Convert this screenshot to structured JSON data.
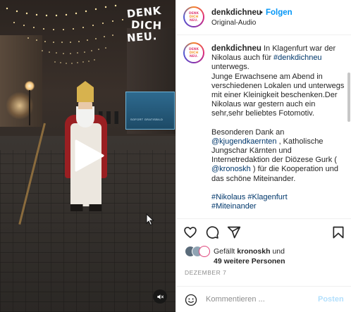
{
  "video": {
    "logo_lines": [
      "DENK",
      "DICH",
      "NEU."
    ],
    "shop_sign_text": "SOFORT GRATISBILD"
  },
  "header": {
    "username": "denkdichneu",
    "separator": "•",
    "follow_label": "Folgen",
    "audio_label": "Original-Audio"
  },
  "avatar": {
    "lines": [
      "DENK",
      "DICH",
      "NEU."
    ]
  },
  "caption": {
    "username": "denkdichneu",
    "p1_intro": " In Klagenfurt war der Nikolaus auch für ",
    "p1_hashtag": "#denkdichneu",
    "p1_rest": " unterwegs.",
    "p2": "Junge Erwachsene am Abend in verschiedenen Lokalen und unterwegs mit einer Kleinigkeit beschenken.Der Nikolaus war gestern auch ein sehr,sehr beliebtes Fotomotiv.",
    "p3_intro": "Besonderen Dank an ",
    "p3_mention1": "@kjugendkaernten",
    "p3_mid1": " , Katholische Jungschar Kärnten und Internetredaktion der Diözese Gurk ( ",
    "p3_mention2": "@kronoskh",
    "p3_rest": " ) für die Kooperation und das schöne Miteinander.",
    "hashtags": [
      "#Nikolaus",
      "#Klagenfurt",
      "#Miteinander"
    ]
  },
  "likes": {
    "prefix": "Gefällt ",
    "user": "kronoskh",
    "and": " und",
    "others": "49 weitere Personen"
  },
  "date": "DEZEMBER 7",
  "comment": {
    "placeholder": "Kommentieren ...",
    "post_label": "Posten"
  },
  "colors": {
    "link": "#00376b",
    "follow": "#0095f6",
    "post_disabled": "#b2dffc",
    "muted": "#8e8e8e"
  },
  "icons": [
    "play-icon",
    "mute-icon",
    "heart-icon",
    "comment-icon",
    "share-icon",
    "bookmark-icon",
    "emoji-icon"
  ]
}
